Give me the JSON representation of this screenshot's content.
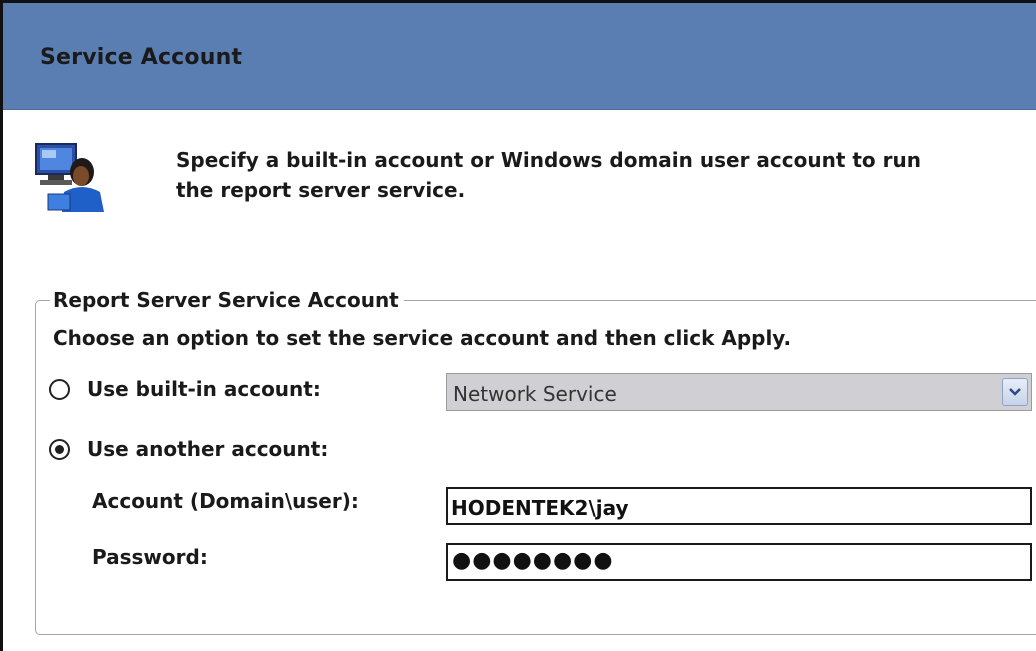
{
  "header": {
    "title": "Service Account"
  },
  "intro": {
    "icon": "user-computer-icon",
    "line1": "Specify a built-in account or Windows domain user account to run",
    "line2": "the report server service."
  },
  "group": {
    "legend": "Report Server Service Account",
    "instruction": "Choose an option to set the service account and then click Apply.",
    "builtin": {
      "label": "Use built-in account:",
      "selected": false,
      "select_value": "Network Service"
    },
    "another": {
      "label": "Use another account:",
      "selected": true
    },
    "account": {
      "label": "Account (Domain\\user):",
      "value": "HODENTEK2\\jay"
    },
    "password": {
      "label": "Password:",
      "value": "●●●●●●●●"
    }
  },
  "colors": {
    "header_bg": "#5a7db2",
    "select_bg": "#cfcfd4"
  }
}
